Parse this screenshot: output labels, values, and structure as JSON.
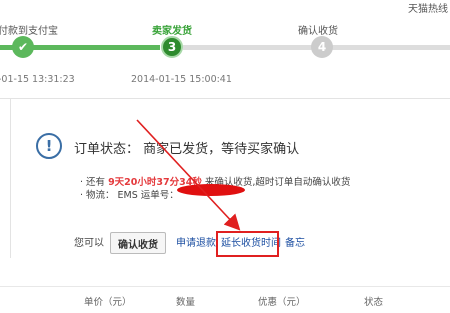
{
  "header": {
    "top_right": "天猫热线"
  },
  "steps": [
    {
      "label": "付款到支付宝",
      "time": "-01-15 13:31:23",
      "number": "✔",
      "state": "done"
    },
    {
      "label": "卖家发货",
      "time": "2014-01-15 15:00:41",
      "number": "3",
      "state": "current"
    },
    {
      "label": "确认收货",
      "time": "",
      "number": "4",
      "state": "todo"
    }
  ],
  "status": {
    "icon": "!",
    "title": "订单状态： 商家已发货，等待买家确认",
    "line1_prefix": "· 还有 ",
    "countdown": "9天20小时37分34秒",
    "line1_suffix": " 来确认收货,超时订单自动确认收货",
    "line2": "· 物流：  EMS   运单号："
  },
  "actions": {
    "prompt": "您可以",
    "confirm_button": "确认收货",
    "refund_link": "申请退款",
    "extend_link": "延长收货时间",
    "note_link": "备忘"
  },
  "table": {
    "headers": [
      "单价（元）",
      "数量",
      "优惠（元）",
      "状态"
    ]
  },
  "colors": {
    "accent_green": "#5cb85c",
    "alert_red": "#e02020",
    "link_blue": "#1d4fa2",
    "countdown_red": "#e4393c"
  }
}
